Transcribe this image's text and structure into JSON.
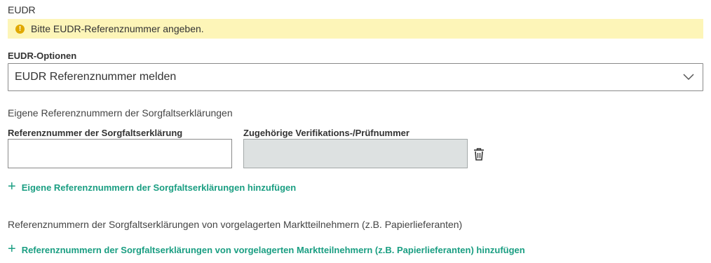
{
  "section": {
    "title": "EUDR",
    "warning_text": "Bitte EUDR-Referenznummer angeben."
  },
  "options": {
    "label": "EUDR-Optionen",
    "selected": "EUDR Referenznummer melden"
  },
  "own_refs": {
    "heading": "Eigene Referenznummern der Sorgfaltserklärungen",
    "col_ref_label": "Referenznummer der Sorgfaltserklärung",
    "col_verif_label": "Zugehörige Verifikations-/Prüfnummer",
    "ref_value": "",
    "verif_value": "",
    "add_label": "Eigene Referenznummern der Sorgfaltserklärungen hinzufügen"
  },
  "upstream_refs": {
    "heading": "Referenznummern der Sorgfaltserklärungen von vorgelagerten Marktteilnehmern (z.B. Papierlieferanten)",
    "add_label": "Referenznummern der Sorgfaltserklärungen von vorgelagerten Marktteilnehmern (z.B. Papierlieferanten) hinzufügen"
  },
  "colors": {
    "accent": "#1a9e82",
    "warning_bg": "#fdf5b8",
    "warning_icon": "#e0a800"
  },
  "icons": {
    "warning": "warning-icon",
    "chevron": "chevron-down-icon",
    "delete": "trash-icon",
    "add": "plus-icon"
  }
}
